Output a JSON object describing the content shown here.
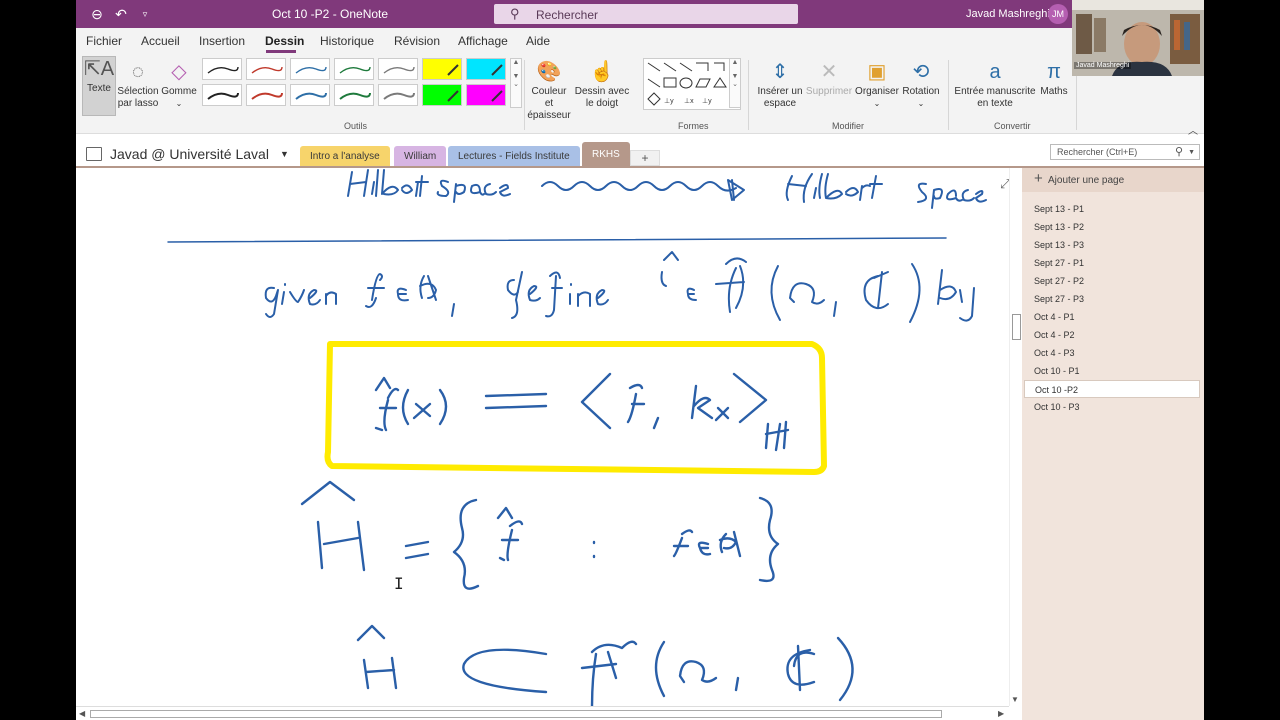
{
  "titlebar": {
    "title": "Oct 10 -P2  -  OneNote",
    "search_placeholder": "Rechercher",
    "user_name": "Javad Mashreghi",
    "user_initials": "JM",
    "color": "#80397b"
  },
  "menu": {
    "items": [
      "Fichier",
      "Accueil",
      "Insertion",
      "Dessin",
      "Historique",
      "Révision",
      "Affichage",
      "Aide"
    ],
    "active": "Dessin"
  },
  "ribbon": {
    "texte": "Texte",
    "selection_lasso": [
      "Sélection",
      "par lasso"
    ],
    "gomme": "Gomme",
    "couleur_epaisseur": [
      "Couleur et",
      "épaisseur"
    ],
    "dessin_doigt": [
      "Dessin avec",
      "le doigt"
    ],
    "inserer_espace": [
      "Insérer un",
      "espace"
    ],
    "supprimer": "Supprimer",
    "organiser": "Organiser",
    "rotation": "Rotation",
    "entree_manuscrite": [
      "Entrée manuscrite",
      "en texte"
    ],
    "maths": "Maths",
    "groups": {
      "outils": "Outils",
      "formes": "Formes",
      "modifier": "Modifier",
      "convertir": "Convertir"
    },
    "pen_colors": [
      "#222222",
      "#c0392b",
      "#2e6fa7",
      "#1e7a3c",
      "#7a7a7a",
      "#222222",
      "#c0392b",
      "#2e6fa7",
      "#1e7a3c",
      "#7a7a7a"
    ],
    "highlighter_colors": [
      "#ffff00",
      "#00e5ff",
      "#00ff00",
      "#ff00ff"
    ]
  },
  "notebook": {
    "name": "Javad @ Université Laval",
    "sections": [
      {
        "label": "Intro a l'analyse",
        "color": "#f7d46b"
      },
      {
        "label": "William",
        "color": "#d7b5e3"
      },
      {
        "label": "Lectures - Fields Institute",
        "color": "#a9c0e6"
      },
      {
        "label": "RKHS",
        "color": "#b5988a"
      }
    ],
    "add_section": "+",
    "search_placeholder": "Rechercher (Ctrl+E)"
  },
  "pages_pane": {
    "add_page": "Ajouter une page",
    "pages": [
      "Sept 13 - P1",
      "Sept 13 - P2",
      "Sept 13 - P3",
      "Sept 27 - P1",
      "Sept 27 - P2",
      "Sept 27 - P3",
      "Oct 4 - P1",
      "Oct 4 - P2",
      "Oct 4 - P3",
      "Oct 10 - P1",
      "Oct 10 -P2",
      "Oct 10 - P3"
    ],
    "selected": "Oct 10 -P2"
  },
  "webcam": {
    "label": "Javad Mashreghi"
  },
  "ink": {
    "color": "#2a5fa8",
    "highlight_color": "#ffeb00"
  }
}
